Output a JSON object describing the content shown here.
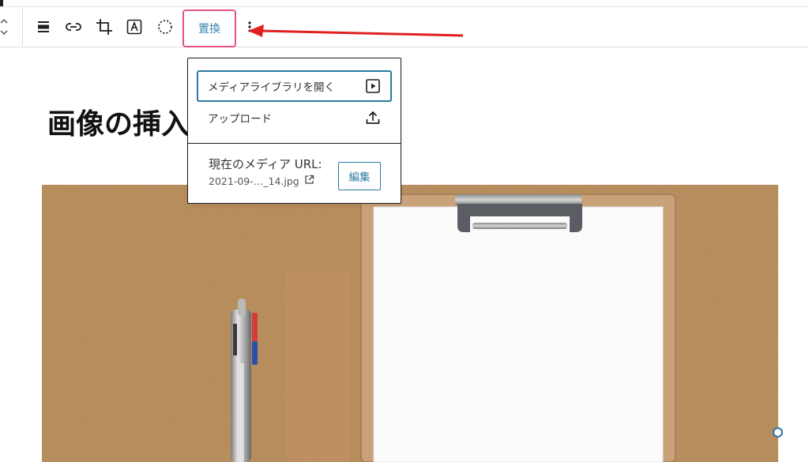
{
  "toolbar": {
    "replace_label": "置換",
    "icons": [
      "move-up-down-icon",
      "align-icon",
      "link-icon",
      "crop-icon",
      "text-overlay-icon",
      "select-circle-icon",
      "more-options-icon"
    ]
  },
  "dropdown": {
    "open_media_library": "メディアライブラリを開く",
    "upload": "アップロード",
    "current_media_label": "現在のメディア URL:",
    "current_media_file": "2021-09-…_14.jpg",
    "edit_label": "編集"
  },
  "content": {
    "heading": "画像の挿入"
  },
  "colors": {
    "accent": "#2a7aa0",
    "highlight_border": "#e8508a",
    "annotation_arrow": "#e02020",
    "cork": "#b98a57"
  }
}
